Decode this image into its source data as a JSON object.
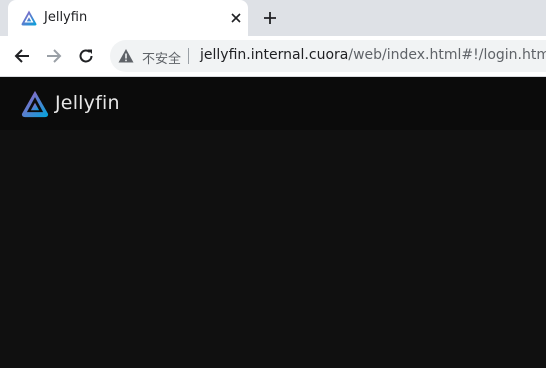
{
  "browser": {
    "tab": {
      "title": "Jellyfin",
      "favicon": "jellyfin-logo-icon",
      "close_icon": "close-icon"
    },
    "new_tab_icon": "plus-icon",
    "nav": {
      "back_icon": "back-arrow-icon",
      "forward_icon": "forward-arrow-icon",
      "reload_icon": "reload-icon"
    },
    "omnibox": {
      "security_icon": "warning-triangle-icon",
      "security_label": "不安全",
      "url_host": "jellyfin.internal.cuora",
      "url_rest": "/web/index.html#!/login.html?"
    }
  },
  "app": {
    "name": "Jellyfin",
    "logo_icon": "jellyfin-logo-icon",
    "colors": {
      "header": "#0b0b0b",
      "background": "#101010",
      "brand_purple": "#aa5cc3",
      "brand_blue": "#00a4dc"
    }
  }
}
